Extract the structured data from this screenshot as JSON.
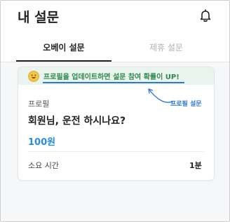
{
  "header": {
    "title": "내 설문"
  },
  "tabs": [
    {
      "label": "오베이 설문",
      "active": true
    },
    {
      "label": "제휴 설문",
      "active": false
    }
  ],
  "card": {
    "banner_text": "프로필을 업데이트하면 설문 참여 확률이 UP!",
    "category": "프로필",
    "question": "회원님, 운전 하시나요?",
    "reward": "100원",
    "time_label": "소요 시간",
    "time_value": "1분"
  },
  "annotation": {
    "label": "프로필 설문"
  },
  "colors": {
    "accent_blue": "#2a8ce0",
    "banner_green_bg": "#eaf4ee",
    "banner_green_text": "#2f8a4a"
  },
  "icons": {
    "bell": "bell-icon",
    "smile": "smile-emoji-icon"
  }
}
